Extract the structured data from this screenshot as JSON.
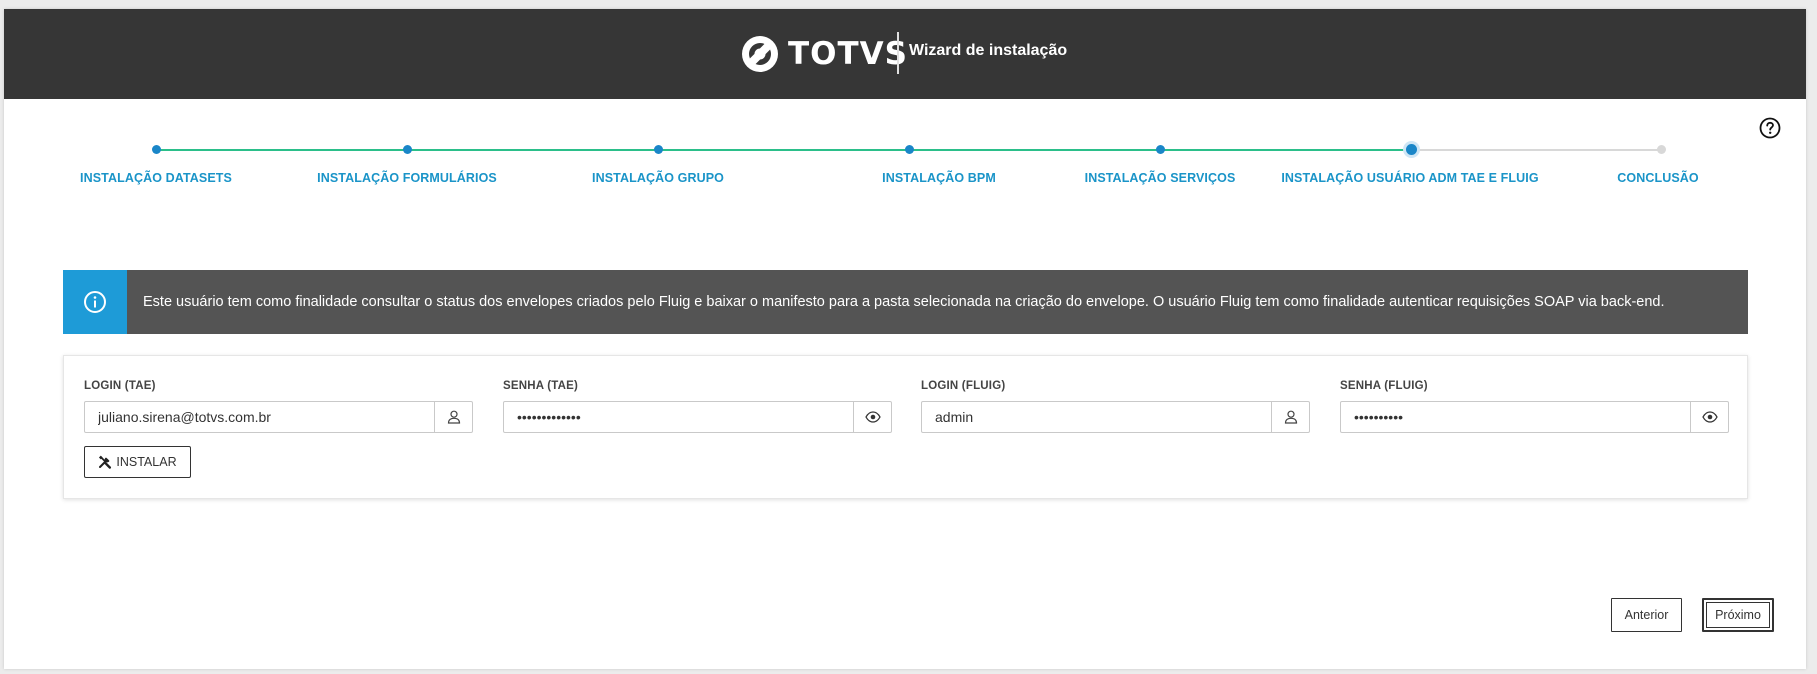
{
  "header": {
    "brand": "TOTVS",
    "title": "Wizard de instalação"
  },
  "help": {
    "icon": "help-circle-icon"
  },
  "stepper": {
    "steps": [
      {
        "label": "INSTALAÇÃO DATASETS",
        "status": "done"
      },
      {
        "label": "INSTALAÇÃO FORMULÁRIOS",
        "status": "done"
      },
      {
        "label": "INSTALAÇÃO GRUPO",
        "status": "done"
      },
      {
        "label": "INSTALAÇÃO BPM",
        "status": "done"
      },
      {
        "label": "INSTALAÇÃO SERVIÇOS",
        "status": "done"
      },
      {
        "label": "INSTALAÇÃO USUÁRIO ADM TAE E FLUIG",
        "status": "current"
      },
      {
        "label": "CONCLUSÃO",
        "status": "pending"
      }
    ],
    "colors": {
      "done_line": "#2bbf8a",
      "dot": "#1a86c8",
      "pending": "#d8d8d8",
      "label": "#1a94c8"
    }
  },
  "info": {
    "icon": "info-circle-icon",
    "text": "Este usuário tem como finalidade consultar o status dos envelopes criados pelo Fluig e baixar o manifesto para a pasta selecionada na criação do envelope. O usuário Fluig tem como finalidade autenticar requisições SOAP via back-end."
  },
  "form": {
    "login_tae": {
      "label": "LOGIN (TAE)",
      "value": "juliano.sirena@totvs.com.br",
      "icon": "user-icon"
    },
    "senha_tae": {
      "label": "SENHA (TAE)",
      "value": "•••••••••••••",
      "icon": "eye-icon"
    },
    "login_fluig": {
      "label": "LOGIN (FLUIG)",
      "value": "admin",
      "icon": "user-icon"
    },
    "senha_fluig": {
      "label": "SENHA (FLUIG)",
      "value": "••••••••••",
      "icon": "eye-icon"
    },
    "install_label": "INSTALAR",
    "install_icon": "tools-icon"
  },
  "footer": {
    "prev_label": "Anterior",
    "next_label": "Próximo"
  }
}
